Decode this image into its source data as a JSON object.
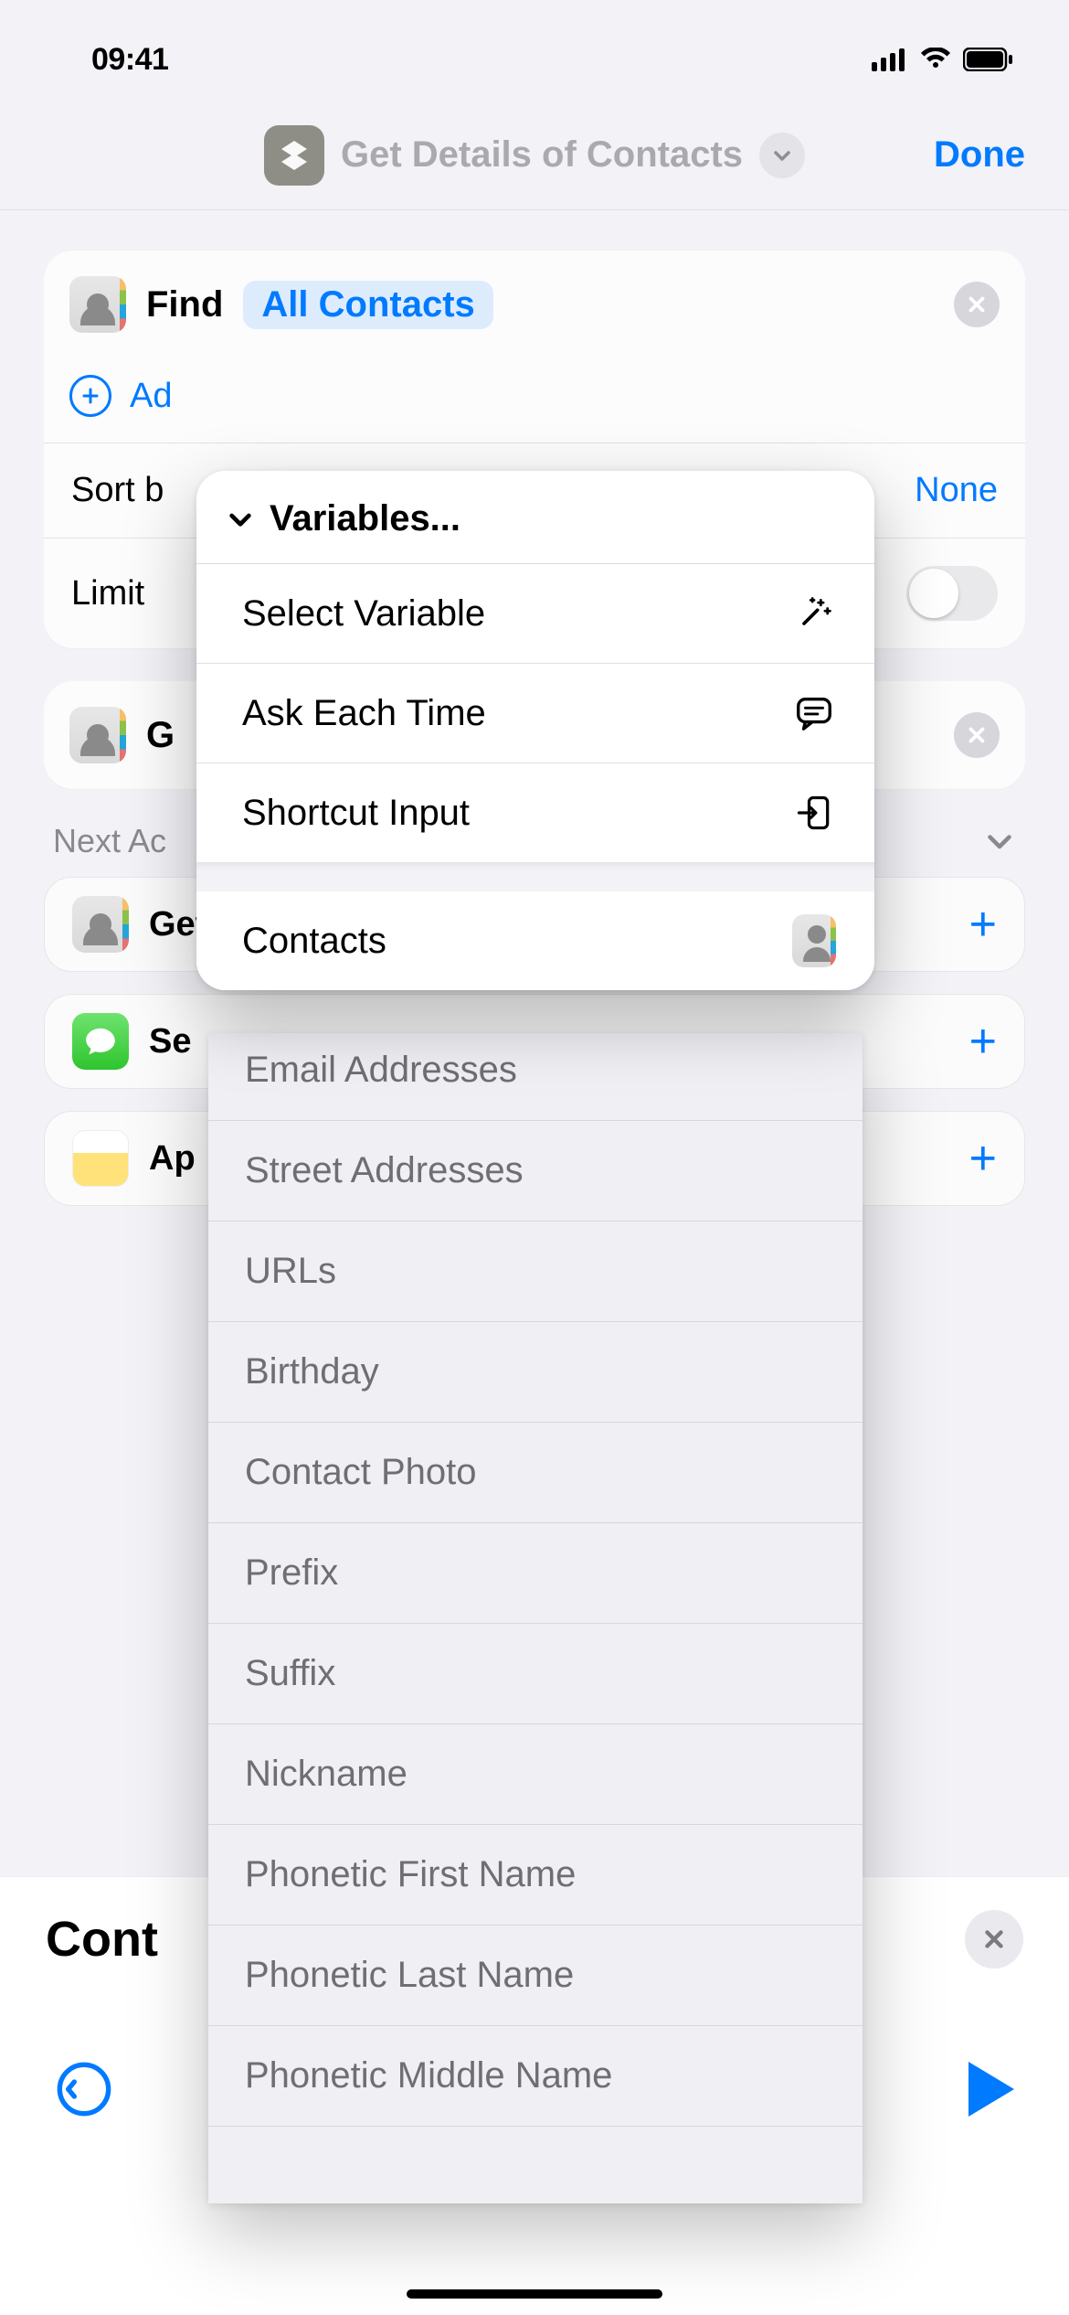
{
  "status": {
    "time": "09:41"
  },
  "nav": {
    "title": "Get Details of Contacts",
    "done": "Done"
  },
  "actions": {
    "find": {
      "verb": "Find",
      "token": "All Contacts"
    },
    "addFilter": "Ad",
    "sortBy": {
      "label": "Sort b",
      "value": "None"
    },
    "limit": {
      "label": "Limit",
      "on": false
    },
    "getDetails": {
      "label": "G"
    }
  },
  "nextSection": {
    "header": "Next Ac"
  },
  "suggestions": [
    {
      "label": "Get",
      "icon": "contacts"
    },
    {
      "label": "Se",
      "icon": "messages"
    },
    {
      "label": "Ap",
      "icon": "notes"
    }
  ],
  "editor": {
    "title": "Cont"
  },
  "popover": {
    "header": "Variables...",
    "items": [
      {
        "label": "Select Variable",
        "icon": "magic"
      },
      {
        "label": "Ask Each Time",
        "icon": "speech"
      },
      {
        "label": "Shortcut Input",
        "icon": "input"
      }
    ],
    "contacts": "Contacts"
  },
  "properties": [
    "Email Addresses",
    "Street Addresses",
    "URLs",
    "Birthday",
    "Contact Photo",
    "Prefix",
    "Suffix",
    "Nickname",
    "Phonetic First Name",
    "Phonetic Last Name",
    "Phonetic Middle Name"
  ]
}
